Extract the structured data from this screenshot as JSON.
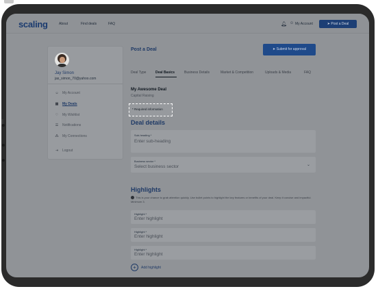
{
  "nav": {
    "logo": "scaling",
    "links": [
      "About",
      "Find deals",
      "FAQ"
    ],
    "account": "My Account",
    "post_button": "Post a Deal"
  },
  "profile": {
    "name": "Jay Simon",
    "email": "jas_simon_70@yahoo.com"
  },
  "sidebar": {
    "items": [
      {
        "label": "My Account",
        "icon": "user-icon",
        "active": false
      },
      {
        "label": "My Deals",
        "icon": "deals-icon",
        "active": true
      },
      {
        "label": "My Wishlist",
        "icon": "heart-icon",
        "active": false
      },
      {
        "label": "Notifications",
        "icon": "document-icon",
        "active": false
      },
      {
        "label": "My Connections",
        "icon": "network-icon",
        "active": false
      },
      {
        "label": "Logout",
        "icon": "logout-icon",
        "active": false
      }
    ]
  },
  "main": {
    "title": "Post a Deal",
    "submit_label": "Submit for approval",
    "tabs": [
      "Deal Type",
      "Deal Basics",
      "Business Details",
      "Market & Competition",
      "Uploads & Media",
      "FAQ"
    ],
    "active_tab": "Deal Basics",
    "deal_name": "My Awesome Deal",
    "deal_subtitle": "Capital Raising",
    "required_note": "* Required information",
    "details_heading": "Deal details",
    "subheading_label": "Sub-heading *",
    "subheading_placeholder": "Enter sub-heading",
    "sector_label": "Business sector *",
    "sector_placeholder": "Select business sector",
    "highlights_heading": "Highlights",
    "highlights_info": "This is your chance to grab attention quickly. Use bullet points to highlight the key features or benefits of your deal. Keep it concise and impactful. Minimum 3.",
    "highlight_label": "Highlight *",
    "highlight_placeholder": "Enter highlight",
    "add_highlight": "Add highlight"
  },
  "colors": {
    "brand": "#1b3b6f",
    "button": "#1f4a8a",
    "overlay": "#909397"
  }
}
